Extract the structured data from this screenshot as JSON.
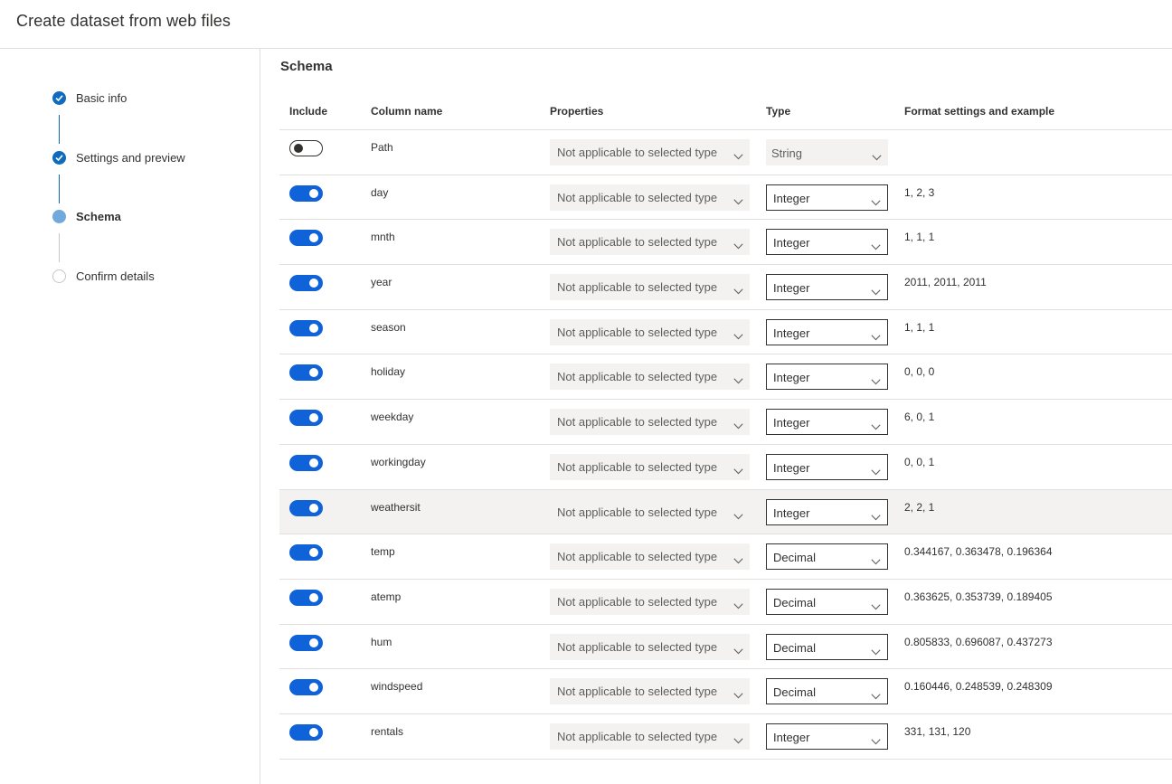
{
  "header": {
    "title": "Create dataset from web files"
  },
  "steps": [
    {
      "label": "Basic info",
      "state": "completed"
    },
    {
      "label": "Settings and preview",
      "state": "completed"
    },
    {
      "label": "Schema",
      "state": "current"
    },
    {
      "label": "Confirm details",
      "state": "pending"
    }
  ],
  "schema": {
    "title": "Schema",
    "columns": {
      "include": "Include",
      "column_name": "Column name",
      "properties": "Properties",
      "type": "Type",
      "format": "Format settings and example"
    },
    "rows": [
      {
        "include": false,
        "name": "Path",
        "properties": "Not applicable to selected type",
        "type": "String",
        "type_disabled": true,
        "example": ""
      },
      {
        "include": true,
        "name": "day",
        "properties": "Not applicable to selected type",
        "type": "Integer",
        "example": "1, 2, 3"
      },
      {
        "include": true,
        "name": "mnth",
        "properties": "Not applicable to selected type",
        "type": "Integer",
        "example": "1, 1, 1"
      },
      {
        "include": true,
        "name": "year",
        "properties": "Not applicable to selected type",
        "type": "Integer",
        "example": "2011, 2011, 2011"
      },
      {
        "include": true,
        "name": "season",
        "properties": "Not applicable to selected type",
        "type": "Integer",
        "example": "1, 1, 1"
      },
      {
        "include": true,
        "name": "holiday",
        "properties": "Not applicable to selected type",
        "type": "Integer",
        "example": "0, 0, 0"
      },
      {
        "include": true,
        "name": "weekday",
        "properties": "Not applicable to selected type",
        "type": "Integer",
        "example": "6, 0, 1"
      },
      {
        "include": true,
        "name": "workingday",
        "properties": "Not applicable to selected type",
        "type": "Integer",
        "example": "0, 0, 1"
      },
      {
        "include": true,
        "name": "weathersit",
        "properties": "Not applicable to selected type",
        "type": "Integer",
        "example": "2, 2, 1",
        "hovered": true
      },
      {
        "include": true,
        "name": "temp",
        "properties": "Not applicable to selected type",
        "type": "Decimal",
        "example": "0.344167, 0.363478, 0.196364"
      },
      {
        "include": true,
        "name": "atemp",
        "properties": "Not applicable to selected type",
        "type": "Decimal",
        "example": "0.363625, 0.353739, 0.189405"
      },
      {
        "include": true,
        "name": "hum",
        "properties": "Not applicable to selected type",
        "type": "Decimal",
        "example": "0.805833, 0.696087, 0.437273"
      },
      {
        "include": true,
        "name": "windspeed",
        "properties": "Not applicable to selected type",
        "type": "Decimal",
        "example": "0.160446, 0.248539, 0.248309"
      },
      {
        "include": true,
        "name": "rentals",
        "properties": "Not applicable to selected type",
        "type": "Integer",
        "example": "331, 131, 120"
      }
    ]
  },
  "icons": {
    "step_completed": "checkmark-icon",
    "dropdown": "chevron-down-icon"
  },
  "colors": {
    "accent": "#0f6cbd",
    "toggle_on": "#0f62d8",
    "current_step": "#71a9dc"
  }
}
